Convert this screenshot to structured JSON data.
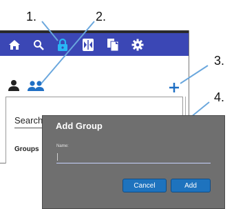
{
  "callouts": [
    "1.",
    "2.",
    "3.",
    "4."
  ],
  "toolbar": {
    "icons": [
      "home-icon",
      "search-icon",
      "lock-icon",
      "tablet-icon",
      "copy-icon",
      "gear-icon"
    ],
    "active_icon": "lock-icon",
    "background": "#3b47b5",
    "active_color": "#29b6f6"
  },
  "tabs": {
    "icons": [
      "user-icon",
      "users-icon"
    ],
    "active": "users-icon",
    "add_icon": "plus-icon"
  },
  "panel": {
    "search_label": "Search",
    "groups_label": "Groups"
  },
  "dialog": {
    "title": "Add Group",
    "name_label": "Name:",
    "name_value": "",
    "cancel_label": "Cancel",
    "add_label": "Add",
    "button_color": "#1e73be"
  }
}
